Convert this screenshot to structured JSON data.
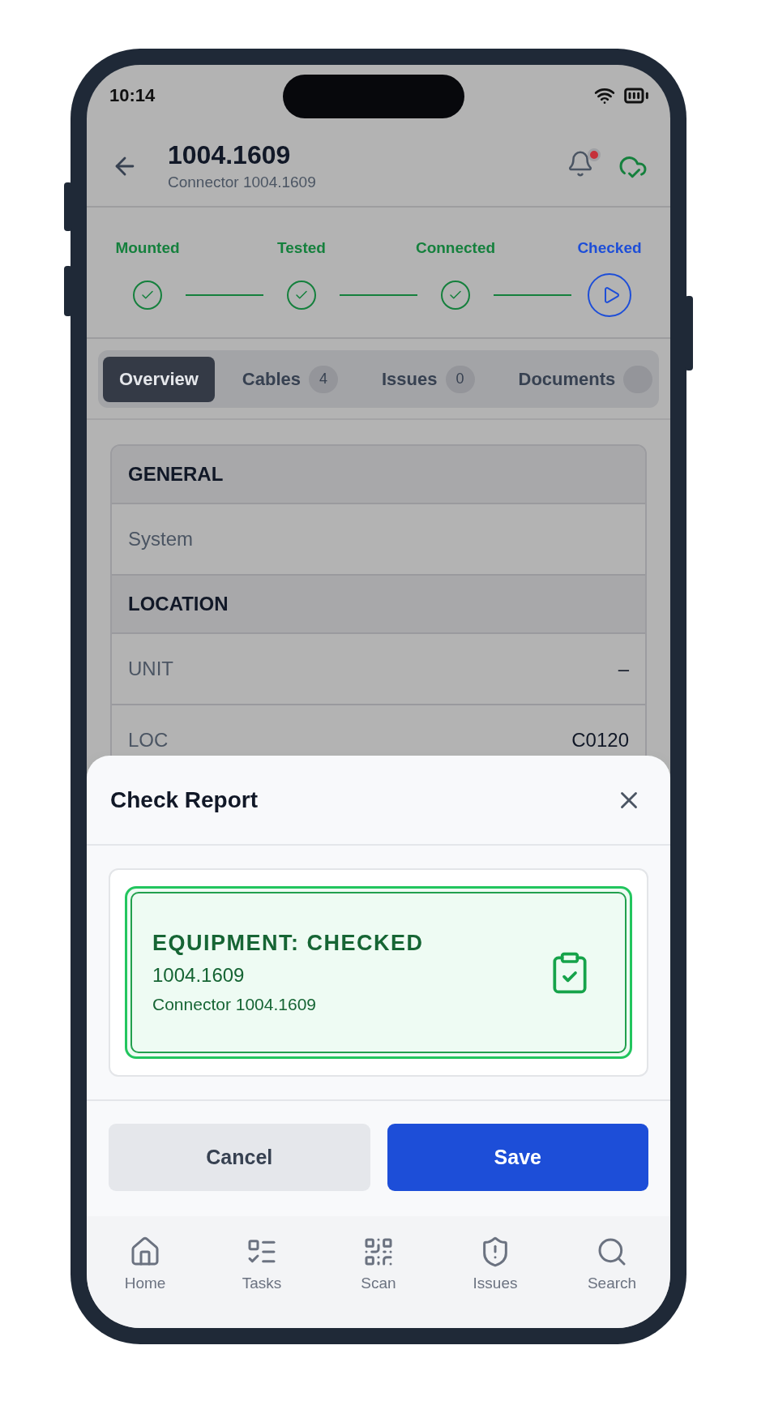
{
  "status_bar": {
    "time": "10:14"
  },
  "header": {
    "title": "1004.1609",
    "subtitle": "Connector 1004.1609",
    "notification_unread": true
  },
  "steps": [
    {
      "label": "Mounted",
      "completed": true
    },
    {
      "label": "Tested",
      "completed": true
    },
    {
      "label": "Connected",
      "completed": true
    },
    {
      "label": "Checked",
      "completed": false
    }
  ],
  "tabs": [
    {
      "label": "Overview",
      "selected": true
    },
    {
      "label": "Cables",
      "count": "4",
      "selected": false
    },
    {
      "label": "Issues",
      "count": "0",
      "selected": false
    },
    {
      "label": "Documents",
      "clipped_badge": true,
      "selected": false
    }
  ],
  "sections": [
    {
      "title": "GENERAL",
      "rows": [
        {
          "label": "System"
        }
      ]
    },
    {
      "title": "LOCATION",
      "rows": [
        {
          "label": "UNIT",
          "value": "–"
        },
        {
          "label": "LOC",
          "value": "C0120"
        }
      ]
    }
  ],
  "sheet": {
    "title": "Check Report",
    "status": {
      "heading": "EQUIPMENT: CHECKED",
      "code": "1004.1609",
      "name": "Connector 1004.1609"
    },
    "buttons": [
      {
        "label": "Cancel",
        "kind": "secondary"
      },
      {
        "label": "Save",
        "kind": "primary"
      }
    ]
  },
  "nav": [
    {
      "label": "Home",
      "kind": "home"
    },
    {
      "label": "Tasks",
      "kind": "tasks"
    },
    {
      "label": "Scan",
      "kind": "scan"
    },
    {
      "label": "Issues",
      "kind": "issues"
    },
    {
      "label": "Search",
      "kind": "search"
    }
  ]
}
